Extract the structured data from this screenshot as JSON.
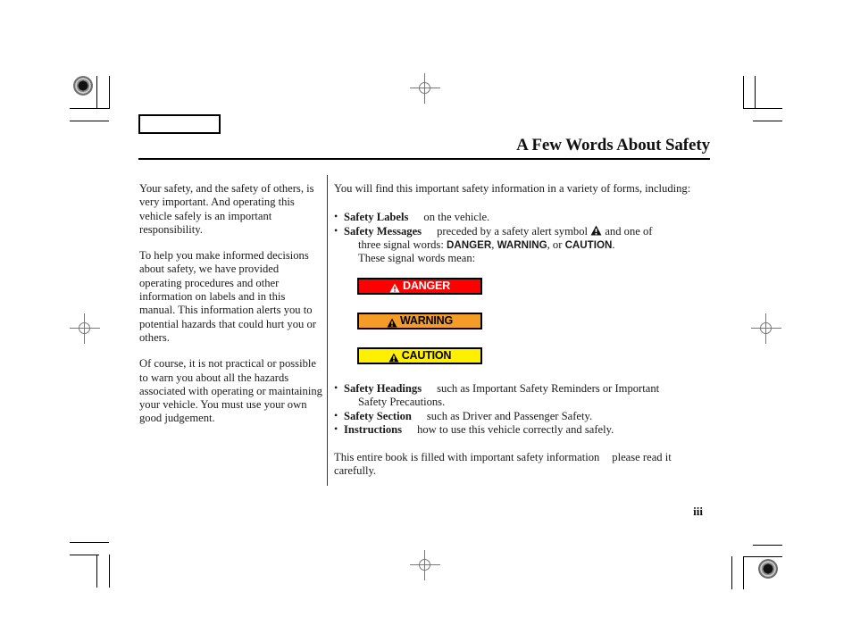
{
  "document": {
    "page_title": "A Few Words About Safety",
    "page_number": "iii"
  },
  "left_column": {
    "paragraphs": [
      "Your safety, and the safety of others, is very important. And operating this vehicle safely is an important responsibility.",
      "To help you make informed decisions about safety, we have provided operating procedures and other information on labels and in this manual. This information alerts you to potential hazards that could hurt you or others.",
      "Of course, it is not practical or possible to warn you about all the hazards associated with operating or maintaining your vehicle. You must use your own good judgement."
    ]
  },
  "right_column": {
    "intro": "You will find this important safety information in a variety of forms, including:",
    "bullets_top": [
      {
        "term": "Safety Labels",
        "text": "on the vehicle."
      },
      {
        "term": "Safety Messages",
        "text_before_symbol": "preceded by a safety alert symbol",
        "symbol": "safety-alert-triangle",
        "text_after_symbol": "and one of",
        "continuation_before": "three signal words:",
        "signal_word_1": "DANGER",
        "signal_sep_1": ",",
        "signal_word_2": "WARNING",
        "signal_sep_2": ", or",
        "signal_word_3": "CAUTION",
        "signal_end": ".",
        "continuation_line": "These signal words mean:"
      }
    ],
    "signal_boxes": [
      {
        "label": "DANGER",
        "background": "#FF0000",
        "text_color": "#FFFFFF",
        "icon": "alert-triangle-icon"
      },
      {
        "label": "WARNING",
        "background": "#F59B28",
        "text_color": "#000000",
        "icon": "alert-triangle-icon"
      },
      {
        "label": "CAUTION",
        "background": "#FFF000",
        "text_color": "#000000",
        "icon": "alert-triangle-icon"
      }
    ],
    "bullets_bottom": [
      {
        "term": "Safety Headings",
        "text": "such as Important Safety Reminders or Important",
        "continuation": "Safety Precautions."
      },
      {
        "term": "Safety Section",
        "text": "such as Driver and Passenger Safety."
      },
      {
        "term": "Instructions",
        "text": "how to use this vehicle correctly and safely."
      }
    ],
    "closing_before": "This entire book is filled with important safety information",
    "closing_after": "please read it carefully."
  }
}
